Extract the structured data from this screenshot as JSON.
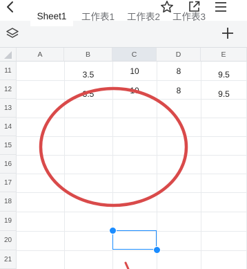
{
  "toolbar": {
    "back_icon": "chevron-left-icon",
    "star_icon": "star-icon",
    "share_icon": "share-icon",
    "menu_icon": "hamburger-menu-icon"
  },
  "sheet_tabs": {
    "layers_icon": "layers-icon",
    "items": [
      "Sheet1",
      "工作表1",
      "工作表2",
      "工作表3"
    ],
    "active_index": 0,
    "add_icon": "plus-icon"
  },
  "grid": {
    "columns": [
      "A",
      "B",
      "C",
      "D",
      "E"
    ],
    "selected_column": "C",
    "rows": [
      "11",
      "12",
      "13",
      "14",
      "15",
      "16",
      "17",
      "18",
      "19",
      "20",
      "21"
    ],
    "cells": {
      "B11": "3.5",
      "C11": "10",
      "D11": "8",
      "E11": "9.5",
      "B12": "3.5",
      "C12": "10",
      "D12": "8",
      "E12": "9.5"
    },
    "selected_cell": "C20"
  },
  "annotation": {
    "shape": "ellipse",
    "stroke_color": "#d94a4a"
  },
  "colors": {
    "accent": "#1a8cff",
    "tabbar_bg": "#f4f5f6",
    "annotation_red": "#d94a4a"
  }
}
